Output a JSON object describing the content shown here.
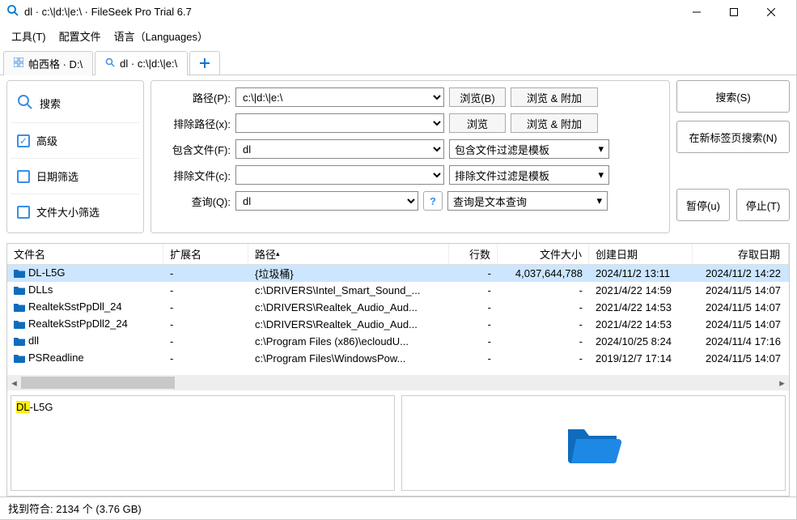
{
  "title_prefix": "dl · c:\\|d:\\|e:\\ · ",
  "app_name": "FileSeek Pro Trial 6.7",
  "menu": {
    "tools": "工具(T)",
    "profiles": "配置文件",
    "lang": "语言（Languages）"
  },
  "tabs": {
    "tab1": "帕西格 · D:\\",
    "tab2": "dl · c:\\|d:\\|e:\\"
  },
  "sidebar": {
    "search_label": "搜索",
    "advanced": "高级",
    "date_filter": "日期筛选",
    "size_filter": "文件大小筛选"
  },
  "form": {
    "path_label": "路径(P):",
    "path_value": "c:\\|d:\\|e:\\",
    "browse": "浏览(B)",
    "browse_attach": "浏览 & 附加",
    "xpath_label": "排除路径(x):",
    "xpath_value": "",
    "browse2": "浏览",
    "inc_label": "包含文件(F):",
    "inc_value": "dl",
    "inc_filter_mode": "包含文件过滤是模板",
    "exc_label": "排除文件(c):",
    "exc_value": "",
    "exc_filter_mode": "排除文件过滤是模板",
    "query_label": "查询(Q):",
    "query_value": "dl",
    "query_mode": "查询是文本查询"
  },
  "buttons": {
    "search": "搜索(S)",
    "newtab_search": "在新标签页搜索(N)",
    "pause": "暂停(u)",
    "stop": "停止(T)"
  },
  "columns": {
    "name": "文件名",
    "ext": "扩展名",
    "path": "路径",
    "lines": "行数",
    "size": "文件大小",
    "created": "创建日期",
    "access": "存取日期"
  },
  "rows": [
    {
      "name": "DL-L5G",
      "ext": "-",
      "path": "{垃圾桶}",
      "lines": "-",
      "size": "4,037,644,788",
      "created": "2024/11/2 13:11",
      "access": "2024/11/2 14:22"
    },
    {
      "name": "DLLs",
      "ext": "-",
      "path": "c:\\DRIVERS\\Intel_Smart_Sound_...",
      "lines": "-",
      "size": "-",
      "created": "2021/4/22 14:59",
      "access": "2024/11/5 14:07"
    },
    {
      "name": "RealtekSstPpDll_24",
      "ext": "-",
      "path": "c:\\DRIVERS\\Realtek_Audio_Aud...",
      "lines": "-",
      "size": "-",
      "created": "2021/4/22 14:53",
      "access": "2024/11/5 14:07"
    },
    {
      "name": "RealtekSstPpDll2_24",
      "ext": "-",
      "path": "c:\\DRIVERS\\Realtek_Audio_Aud...",
      "lines": "-",
      "size": "-",
      "created": "2021/4/22 14:53",
      "access": "2024/11/5 14:07"
    },
    {
      "name": "dll",
      "ext": "-",
      "path": "c:\\Program Files (x86)\\ecloudU...",
      "lines": "-",
      "size": "-",
      "created": "2024/10/25 8:24",
      "access": "2024/11/4 17:16"
    },
    {
      "name": "PSReadline",
      "ext": "-",
      "path": "c:\\Program Files\\WindowsPow...",
      "lines": "-",
      "size": "-",
      "created": "2019/12/7 17:14",
      "access": "2024/11/5 14:07"
    }
  ],
  "preview": {
    "highlight": "DL",
    "rest": "-L5G"
  },
  "status": "找到符合: 2134 个 (3.76 GB)"
}
